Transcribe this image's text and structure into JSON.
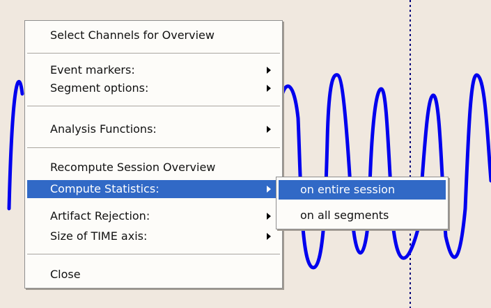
{
  "context_menu": {
    "items": [
      {
        "label": "Select Channels for Overview"
      },
      {
        "label": "Event  markers:"
      },
      {
        "label": "Segment options:"
      },
      {
        "label": "Analysis Functions:"
      },
      {
        "label": "Recompute Session Overview"
      },
      {
        "label": "Compute Statistics:"
      },
      {
        "label": "Artifact Rejection:"
      },
      {
        "label": "Size of TIME axis:"
      },
      {
        "label": "Close"
      }
    ]
  },
  "submenu": {
    "items": [
      {
        "label": "on entire session"
      },
      {
        "label": "on all segments"
      }
    ]
  },
  "colors": {
    "background": "#f0e8df",
    "signal": "#0000ee",
    "cursor_line": "#00007a",
    "highlight": "#3169c6"
  }
}
